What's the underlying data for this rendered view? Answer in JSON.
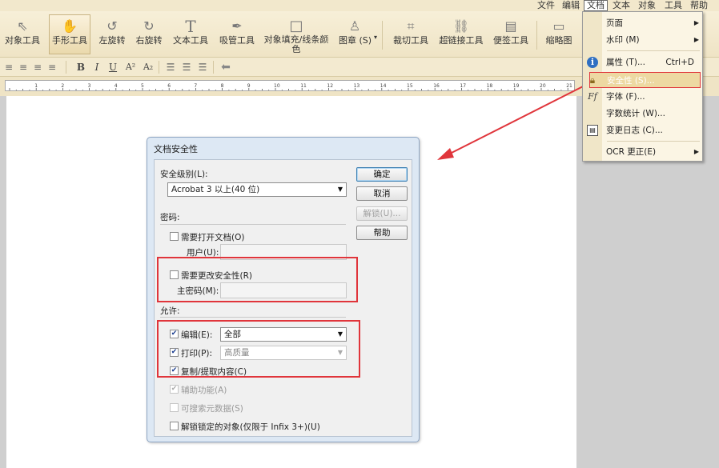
{
  "menubar": {
    "items": [
      {
        "label": "文件"
      },
      {
        "label": "编辑"
      },
      {
        "label": "文档"
      },
      {
        "label": "文本"
      },
      {
        "label": "对象"
      },
      {
        "label": "工具"
      },
      {
        "label": "帮助"
      }
    ]
  },
  "toolbar": {
    "tools": [
      {
        "label": "对象工具",
        "icon": "pointer-arrow-icon"
      },
      {
        "label": "手形工具",
        "icon": "hand-icon",
        "selected": true
      },
      {
        "label": "左旋转",
        "icon": "rotate-left-icon"
      },
      {
        "label": "右旋转",
        "icon": "rotate-right-icon"
      },
      {
        "label": "文本工具",
        "icon": "text-t-icon"
      },
      {
        "label": "吸管工具",
        "icon": "eyedropper-icon"
      },
      {
        "label": "对象填充/线条颜色",
        "icon": "color-square-icon"
      },
      {
        "label": "图章 (S)",
        "icon": "stamp-icon"
      },
      {
        "label": "裁切工具",
        "icon": "crop-icon"
      },
      {
        "label": "超链接工具",
        "icon": "link-icon"
      },
      {
        "label": "便签工具",
        "icon": "note-icon"
      },
      {
        "label": "缩略图",
        "icon": "thumbnail-icon"
      }
    ]
  },
  "formatbar": {
    "bold": "B",
    "italic": "I",
    "underline": "U",
    "superscript": "A²",
    "subscript": "A₂"
  },
  "ruler": {
    "numbers": [
      "1",
      "2",
      "3",
      "4",
      "5",
      "6",
      "7",
      "8",
      "9",
      "10",
      "11",
      "12",
      "13",
      "14",
      "15",
      "16",
      "17",
      "18",
      "19",
      "20",
      "21"
    ]
  },
  "dialog": {
    "title": "文档安全性",
    "security_level_label": "安全级别(L):",
    "security_level_value": "Acrobat 3 以上(40 位)",
    "password_section": "密码:",
    "require_open_label": "需要打开文档(O)",
    "user_label": "用户(U):",
    "user_value": "",
    "require_change_label": "需要更改安全性(R)",
    "master_label": "主密码(M):",
    "master_value": "",
    "allow_section": "允许:",
    "edit_label": "编辑(E):",
    "edit_value": "全部",
    "print_label": "打印(P):",
    "print_value": "高质量",
    "copy_label": "复制/提取内容(C)",
    "accessibility_label": "辅助功能(A)",
    "searchable_label": "可搜索元数据(S)",
    "unlock_objects_label": "解锁锁定的对象(仅限于 Infix 3+)(U)",
    "checks": {
      "require_open": false,
      "require_change": false,
      "edit": true,
      "print": true,
      "copy": true,
      "accessibility": true,
      "searchable": false,
      "unlock_objects": false
    },
    "buttons": {
      "ok": "确定",
      "cancel": "取消",
      "unlock": "解锁(U)...",
      "help": "帮助"
    }
  },
  "dropdown": {
    "items": [
      {
        "label": "页面",
        "shortcut": "",
        "submenu": true,
        "icon": ""
      },
      {
        "label": "水印 (M)",
        "shortcut": "",
        "submenu": true,
        "icon": ""
      },
      {
        "label": "属性 (T)...",
        "shortcut": "Ctrl+D",
        "submenu": false,
        "icon": "info-icon"
      },
      {
        "label": "安全性 (S)...",
        "shortcut": "",
        "submenu": false,
        "icon": "lock-icon",
        "highlighted": true
      },
      {
        "label": "字体 (F)...",
        "shortcut": "",
        "submenu": false,
        "icon": "font-icon"
      },
      {
        "label": "字数统计 (W)...",
        "shortcut": "",
        "submenu": false,
        "icon": ""
      },
      {
        "label": "变更日志 (C)...",
        "shortcut": "",
        "submenu": false,
        "icon": "changelog-icon"
      },
      {
        "label": "OCR 更正(E)",
        "shortcut": "",
        "submenu": true,
        "icon": ""
      }
    ]
  },
  "colors": {
    "annotation_red": "#e0353b",
    "menu_highlight": "#edd9a2",
    "toolbar_bg": "#f3ead0"
  }
}
